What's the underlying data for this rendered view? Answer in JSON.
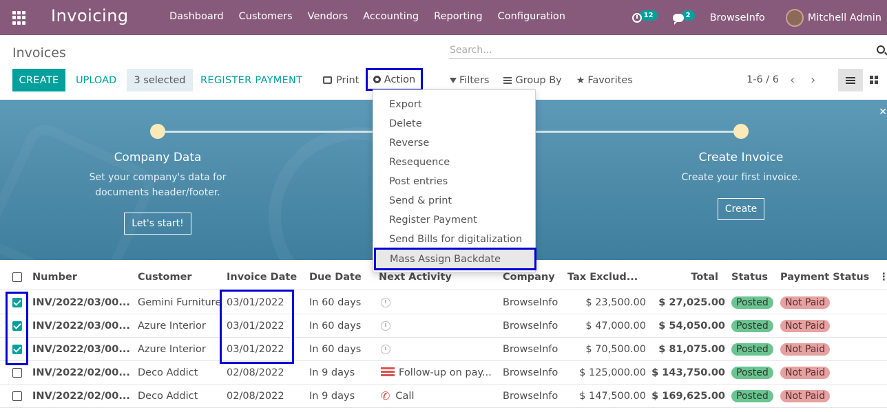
{
  "navbar": {
    "app_name": "Invoicing",
    "menu": [
      "Dashboard",
      "Customers",
      "Vendors",
      "Accounting",
      "Reporting",
      "Configuration"
    ],
    "activity_count": "12",
    "message_count": "2",
    "company": "BrowseInfo",
    "user": "Mitchell Admin"
  },
  "control": {
    "title": "Invoices",
    "search_placeholder": "Search...",
    "create": "CREATE",
    "upload": "UPLOAD",
    "selected": "3 selected",
    "register_payment": "REGISTER PAYMENT",
    "print": "Print",
    "action": "Action",
    "filters": "Filters",
    "group_by": "Group By",
    "favorites": "Favorites",
    "pager": "1-6 / 6"
  },
  "banner": {
    "step1_title": "Company Data",
    "step1_desc_1": "Set your company's data for",
    "step1_desc_2": "documents header/footer.",
    "step1_button": "Let's start!",
    "step2_title": "Create Invoice",
    "step2_desc": "Create your first invoice.",
    "step2_button": "Create"
  },
  "action_menu": [
    "Export",
    "Delete",
    "Reverse",
    "Resequence",
    "Post entries",
    "Send & print",
    "Register Payment",
    "Send Bills for digitalization",
    "Mass Assign Backdate"
  ],
  "table": {
    "headers": [
      "Number",
      "Customer",
      "Invoice Date",
      "Due Date",
      "Next Activity",
      "Company",
      "Tax Exclud...",
      "Total",
      "Status",
      "Payment Status"
    ],
    "rows": [
      {
        "number": "INV/2022/03/00...",
        "customer": "Gemini Furniture",
        "invoice_date": "03/01/2022",
        "due": "In 60 days",
        "activity": "",
        "company": "BrowseInfo",
        "tax_excl": "$ 23,500.00",
        "total": "$ 27,025.00",
        "status": "Posted",
        "payment": "Not Paid"
      },
      {
        "number": "INV/2022/03/00...",
        "customer": "Azure Interior",
        "invoice_date": "03/01/2022",
        "due": "In 60 days",
        "activity": "",
        "company": "BrowseInfo",
        "tax_excl": "$ 47,000.00",
        "total": "$ 54,050.00",
        "status": "Posted",
        "payment": "Not Paid"
      },
      {
        "number": "INV/2022/03/00...",
        "customer": "Azure Interior",
        "invoice_date": "03/01/2022",
        "due": "In 60 days",
        "activity": "",
        "company": "BrowseInfo",
        "tax_excl": "$ 70,500.00",
        "total": "$ 81,075.00",
        "status": "Posted",
        "payment": "Not Paid"
      },
      {
        "number": "INV/2022/02/00...",
        "customer": "Deco Addict",
        "invoice_date": "02/08/2022",
        "due": "In 9 days",
        "activity": "Follow-up on pay...",
        "company": "BrowseInfo",
        "tax_excl": "$ 125,000.00",
        "total": "$ 143,750.00",
        "status": "Posted",
        "payment": "Not Paid"
      },
      {
        "number": "INV/2022/02/00...",
        "customer": "Deco Addict",
        "invoice_date": "02/08/2022",
        "due": "In 9 days",
        "activity": "Call",
        "company": "BrowseInfo",
        "tax_excl": "$ 147,500.00",
        "total": "$ 169,625.00",
        "status": "Posted",
        "payment": "Not Paid"
      }
    ]
  },
  "colors": {
    "brand": "#875a7b",
    "accent": "#00a09d",
    "highlight": "#0000d6"
  }
}
